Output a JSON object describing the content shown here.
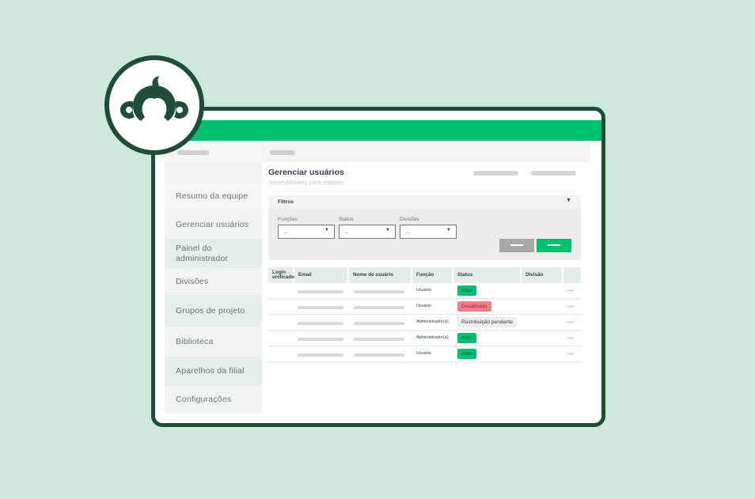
{
  "page": {
    "title": "Gerenciar usuários",
    "subtitle": "SurveyMonkey para equipes"
  },
  "sidebar": {
    "items": [
      {
        "label": "Resumo da equipe"
      },
      {
        "label": "Gerenciar usuários"
      },
      {
        "label": "Painel do administrador"
      },
      {
        "label": "Divisões"
      },
      {
        "label": "Grupos de projeto"
      },
      {
        "label": "Biblioteca"
      },
      {
        "label": "Aparelhos da filial"
      },
      {
        "label": "Configurações"
      }
    ]
  },
  "filters": {
    "title": "Filtros",
    "caret": "▼",
    "fields": [
      {
        "label": "Funções",
        "value": "..."
      },
      {
        "label": "Status",
        "value": "..."
      },
      {
        "label": "Divisões",
        "value": "..."
      }
    ]
  },
  "table": {
    "columns": [
      "Login unificado",
      "Email",
      "Nome de usuário",
      "Função",
      "Status",
      "Divisão"
    ],
    "rows": [
      {
        "role": "Usuário",
        "status": "Ativo",
        "status_kind": "ok"
      },
      {
        "role": "Usuário",
        "status": "Desativado",
        "status_kind": "off"
      },
      {
        "role": "Administrador(a)",
        "status": "Restribuição pendente",
        "status_kind": "pend"
      },
      {
        "role": "Administrador(a)",
        "status": "Ativo",
        "status_kind": "ok"
      },
      {
        "role": "Usuário",
        "status": "Ativo",
        "status_kind": "ok"
      }
    ],
    "more_glyph": "•••"
  },
  "colors": {
    "background": "#cde9dc",
    "brand_green": "#00bf6f",
    "dark_green": "#1f4d38",
    "danger": "#f07f88"
  },
  "icons": {
    "logo": "surveymonkey-logo-icon",
    "more": "more-dots-icon",
    "dropdown": "chevron-down-icon"
  }
}
